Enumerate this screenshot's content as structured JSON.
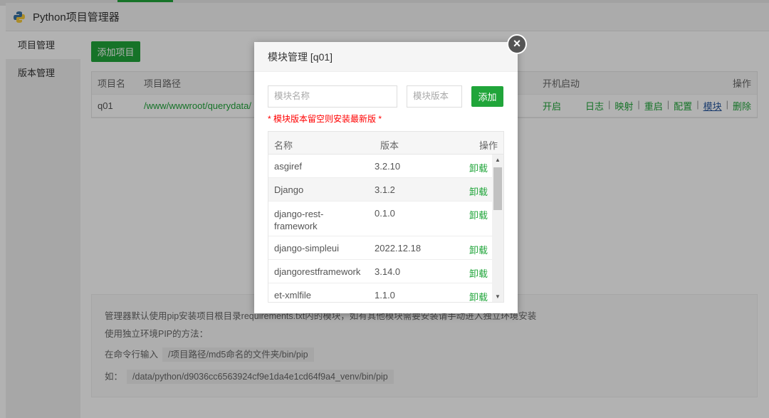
{
  "app": {
    "title": "Python项目管理器"
  },
  "sidebar": {
    "items": [
      {
        "label": "项目管理"
      },
      {
        "label": "版本管理"
      }
    ]
  },
  "main": {
    "add_button": "添加项目",
    "table": {
      "headers": [
        "项目名",
        "项目路径",
        "开机启动",
        "操作"
      ],
      "rows": [
        {
          "name": "q01",
          "path": "/www/wwwroot/querydata/",
          "startup": "开启",
          "actions": [
            "日志",
            "映射",
            "重启",
            "配置",
            "模块",
            "删除"
          ]
        }
      ]
    },
    "info": {
      "line1": "管理器默认使用pip安装项目根目录requirements.txt内的模块，如有其他模块需要安装请手动进入独立环境安装",
      "line2": "使用独立环境PIP的方法：",
      "line3_label": "在命令行输入",
      "line3_code": "/项目路径/md5命名的文件夹/bin/pip",
      "line4_label": "如：",
      "line4_code": "/data/python/d9036cc6563924cf9e1da4e1cd64f9a4_venv/bin/pip"
    }
  },
  "modal": {
    "title": "模块管理 [q01]",
    "name_placeholder": "模块名称",
    "version_placeholder": "模块版本",
    "add_label": "添加",
    "note": "* 模块版本留空则安装最新版 *",
    "headers": [
      "名称",
      "版本",
      "操作"
    ],
    "rows": [
      {
        "name": "asgiref",
        "version": "3.2.10",
        "action": "卸载"
      },
      {
        "name": "Django",
        "version": "3.1.2",
        "action": "卸载"
      },
      {
        "name": "django-rest-framework",
        "version": "0.1.0",
        "action": "卸载"
      },
      {
        "name": "django-simpleui",
        "version": "2022.12.18",
        "action": "卸载"
      },
      {
        "name": "djangorestframework",
        "version": "3.14.0",
        "action": "卸载"
      },
      {
        "name": "et-xmlfile",
        "version": "1.1.0",
        "action": "卸载"
      }
    ],
    "close_icon": "close-icon"
  },
  "colors": {
    "accent": "#20a53a",
    "note": "#ff0000"
  }
}
